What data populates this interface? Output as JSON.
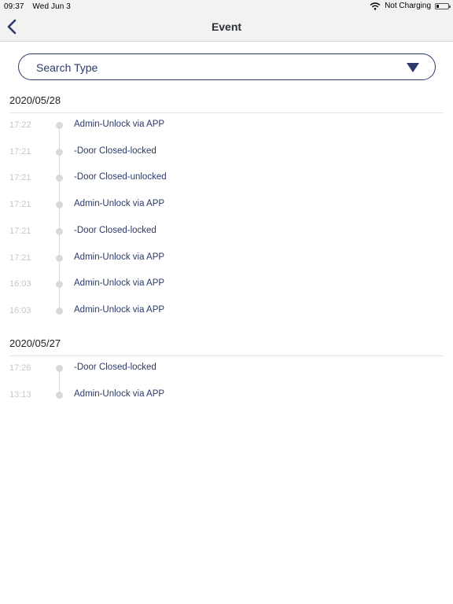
{
  "status_bar": {
    "time": "09:37",
    "date": "Wed Jun 3",
    "charging": "Not Charging"
  },
  "nav": {
    "title": "Event",
    "back_icon": "chevron-left-icon"
  },
  "search": {
    "label": "Search Type",
    "icon": "triangle-down-icon"
  },
  "days": [
    {
      "date": "2020/05/28",
      "events": [
        {
          "time": "17:22",
          "text": "Admin-Unlock via APP"
        },
        {
          "time": "17:21",
          "text": "-Door Closed-locked"
        },
        {
          "time": "17:21",
          "text": "-Door Closed-unlocked"
        },
        {
          "time": "17:21",
          "text": "Admin-Unlock via APP"
        },
        {
          "time": "17:21",
          "text": "-Door Closed-locked"
        },
        {
          "time": "17:21",
          "text": "Admin-Unlock via APP"
        },
        {
          "time": "16:03",
          "text": "Admin-Unlock via APP"
        },
        {
          "time": "16:03",
          "text": "Admin-Unlock via APP"
        }
      ]
    },
    {
      "date": "2020/05/27",
      "events": [
        {
          "time": "17:26",
          "text": "-Door Closed-locked"
        },
        {
          "time": "13:13",
          "text": "Admin-Unlock via APP"
        }
      ]
    }
  ],
  "colors": {
    "accent": "#2c3a6b",
    "time_text": "#c7c7c7",
    "timeline": "#d9d9d9"
  }
}
